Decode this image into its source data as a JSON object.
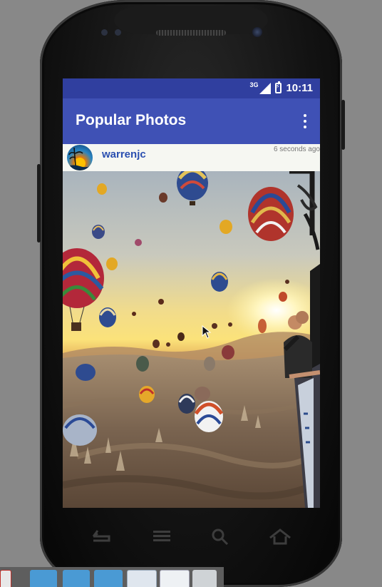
{
  "status_bar": {
    "network_label": "3G",
    "time": "10:11"
  },
  "app_bar": {
    "title": "Popular Photos"
  },
  "post": {
    "username": "warrenjc",
    "timestamp": "6 seconds ago"
  },
  "icons": {
    "signal": "signal-icon",
    "battery": "battery-charging-icon",
    "overflow": "more-vert-icon",
    "back": "back-icon",
    "menu": "menu-icon",
    "search": "search-icon",
    "home": "home-icon"
  },
  "colors": {
    "status_bar": "#303f9f",
    "app_bar": "#3f51b5",
    "username": "#2a4fb0"
  }
}
